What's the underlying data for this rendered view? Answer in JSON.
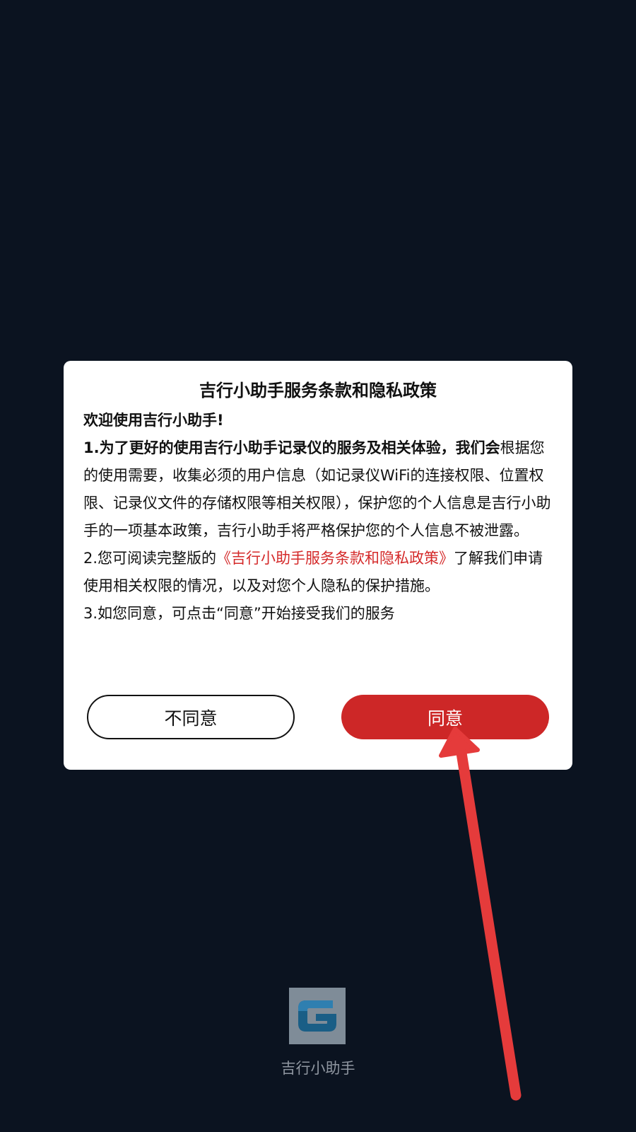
{
  "dialog": {
    "title": "吉行小助手服务条款和隐私政策",
    "welcome": "欢迎使用吉行小助手!",
    "para1_bold": "1.为了更好的使用吉行小助手记录仪的服务及相关体验，我们会",
    "para1_rest": "根据您的使用需要，收集必须的用户信息（如记录仪WiFi的连接权限、位置权限、记录仪文件的存储权限等相关权限），保护您的个人信息是吉行小助手的一项基本政策，吉行小助手将严格保护您的个人信息不被泄露。",
    "para2_prefix": "2.您可阅读完整版的",
    "para2_link": "《吉行小助手服务条款和隐私政策》",
    "para2_suffix": "了解我们申请使用相关权限的情况，以及对您个人隐私的保护措施。",
    "para3": "3.如您同意，可点击“同意”开始接受我们的服务",
    "disagree_label": "不同意",
    "agree_label": "同意"
  },
  "app": {
    "name": "吉行小助手",
    "logo_icon": "g-logo-icon"
  },
  "colors": {
    "background": "#0b1320",
    "accent_red": "#cd2727",
    "link_red": "#d42a2a",
    "arrow_red": "#e53b3b"
  }
}
